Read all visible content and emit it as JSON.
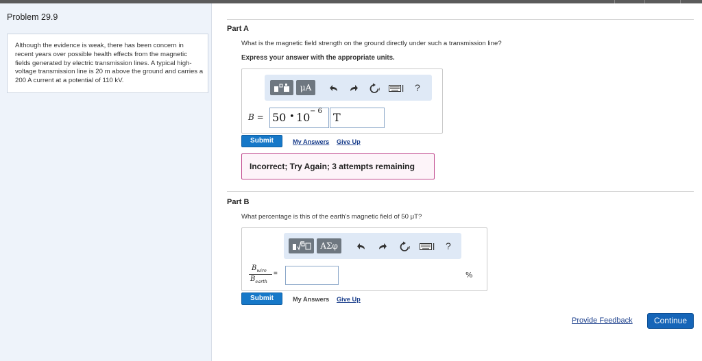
{
  "problem": {
    "title": "Problem 29.9",
    "text": "Although the evidence is weak, there has been concern in recent years over possible health effects from the magnetic fields generated by electric transmission lines. A typical high-voltage transmission line is 20 m above the ground and carries a 200 A current at a potential of 110 kV."
  },
  "partA": {
    "title": "Part A",
    "question": "What is the magnetic field strength on the ground directly under such a transmission line?",
    "instruction": "Express your answer with the appropriate units.",
    "toolbar": {
      "templates_icon": "templates-icon",
      "units_label": "μA",
      "undo_icon": "undo-icon",
      "redo_icon": "redo-icon",
      "reset_icon": "reset-icon",
      "keyboard_icon": "keyboard-icon",
      "help_label": "?"
    },
    "var_label": "B =",
    "answer_mantissa": "50",
    "answer_dot": "•",
    "answer_base": "10",
    "answer_exponent": "− 6",
    "unit_value": "T",
    "submit_label": "Submit",
    "my_answers_label": "My Answers",
    "give_up_label": "Give Up",
    "feedback": "Incorrect; Try Again; 3 attempts remaining"
  },
  "partB": {
    "title": "Part B",
    "question": "What percentage is this of the earth's magnetic field of 50 μT?",
    "toolbar": {
      "templates_icon": "templates-icon",
      "symbols_label": "ΑΣφ",
      "undo_icon": "undo-icon",
      "redo_icon": "redo-icon",
      "reset_icon": "reset-icon",
      "keyboard_icon": "keyboard-icon",
      "help_label": "?"
    },
    "frac_num": "B",
    "frac_num_sub": "wire",
    "frac_den": "B",
    "frac_den_sub": "earth",
    "equals": "=",
    "answer_value": "",
    "unit": "%",
    "submit_label": "Submit",
    "my_answers_label": "My Answers",
    "give_up_label": "Give Up"
  },
  "footer": {
    "provide_feedback_label": "Provide Feedback",
    "continue_label": "Continue"
  },
  "colors": {
    "accent": "#1678c8",
    "feedback_border": "#c0468c",
    "toolbar_bg": "#dfe9f6"
  }
}
